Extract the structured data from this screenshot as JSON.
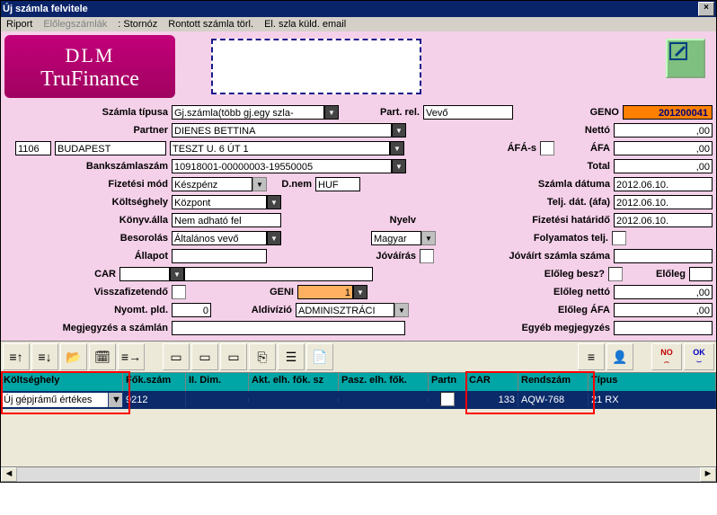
{
  "window": {
    "title": "Új számla felvitele"
  },
  "menu": {
    "riport": "Riport",
    "elolegszamlak": "Előlegszámlák",
    "storno": ": Stornóz",
    "rontott": "Rontott számla törl.",
    "elszla": "El. szla küld. email"
  },
  "logo": {
    "line1": "DLM",
    "line2": "TruFinance"
  },
  "labels": {
    "szamla_tipusa": "Számla típusa",
    "part_rel": "Part. rel.",
    "geno": "GENO",
    "partner": "Partner",
    "netto": "Nettó",
    "afas": "ÁFÁ-s",
    "afa": "ÁFA",
    "bankszamlaszam": "Bankszámlaszám",
    "total": "Total",
    "fizetesi_mod": "Fizetési mód",
    "dnem": "D.nem",
    "szamla_datuma": "Számla dátuma",
    "koltseghely": "Költséghely",
    "telj_dat": "Telj. dát. (áfa)",
    "konyvalla": "Könyv.álla",
    "nyelv": "Nyelv",
    "fizetesi_hatarido": "Fizetési határidő",
    "besorolas": "Besorolás",
    "folyamatos_telj": "Folyamatos telj.",
    "allapot": "Állapot",
    "jovairas": "Jóváírás",
    "jovairt_szamla": "Jóváírt számla száma",
    "car": "CAR",
    "eloleg_besz": "Előleg besz?",
    "eloleg": "Előleg",
    "visszafizetendo": "Visszafizetendő",
    "geni": "GENI",
    "eloleg_netto": "Előleg nettó",
    "nyomt_pld": "Nyomt. pld.",
    "aldivizio": "Aldivízió",
    "eloleg_afa": "Előleg ÁFA",
    "megjegyzes": "Megjegyzés a számlán",
    "egyeb": "Egyéb megjegyzés"
  },
  "values": {
    "szamla_tipusa": "Gj.számla(több gj.egy szla-",
    "part_rel": "Vevő",
    "geno": "201200041",
    "partner": "DIENES BETTINA",
    "netto": ",00",
    "irsz": "1106",
    "varos": "BUDAPEST",
    "cim": "TESZT U. 6 ÚT 1",
    "afa": ",00",
    "bankszamlaszam": "10918001-00000003-19550005",
    "total": ",00",
    "fizetesi_mod": "Készpénz",
    "dnem": "HUF",
    "szamla_datuma": "2012.06.10.",
    "koltseghely": "Központ",
    "telj_dat": "2012.06.10.",
    "konyvalla": "Nem adható fel",
    "fizetesi_hatarido": "2012.06.10.",
    "besorolas": "Általános vevő",
    "nyelv": "Magyar",
    "allapot": "",
    "jovairt_szamla": "",
    "car": "",
    "eloleg": "",
    "geni": "1",
    "eloleg_netto": ",00",
    "nyomt_pld": "0",
    "aldivizio": "ADMINISZTRÁCI",
    "eloleg_afa": ",00",
    "megjegyzes": ""
  },
  "grid": {
    "headers": {
      "koltseghely": "Költséghely",
      "fokszam": "Fők.szám",
      "iidim": "II. Dim.",
      "aktelh": "Akt. elh. fők. sz",
      "paszelh": "Pasz. elh. fők.",
      "partn": "Partn",
      "car": "CAR",
      "rendszam": "Rendszám",
      "tipus": "Típus"
    },
    "row": {
      "koltseghely": "Új gépjrámű értékes",
      "fokszam": "9212",
      "iidim": "",
      "aktelh": "",
      "paszelh": "",
      "partn": "",
      "car": "133",
      "rendszam": "AQW-768",
      "tipus": "21 RX"
    }
  },
  "buttons": {
    "no": "NO",
    "ok": "OK"
  }
}
